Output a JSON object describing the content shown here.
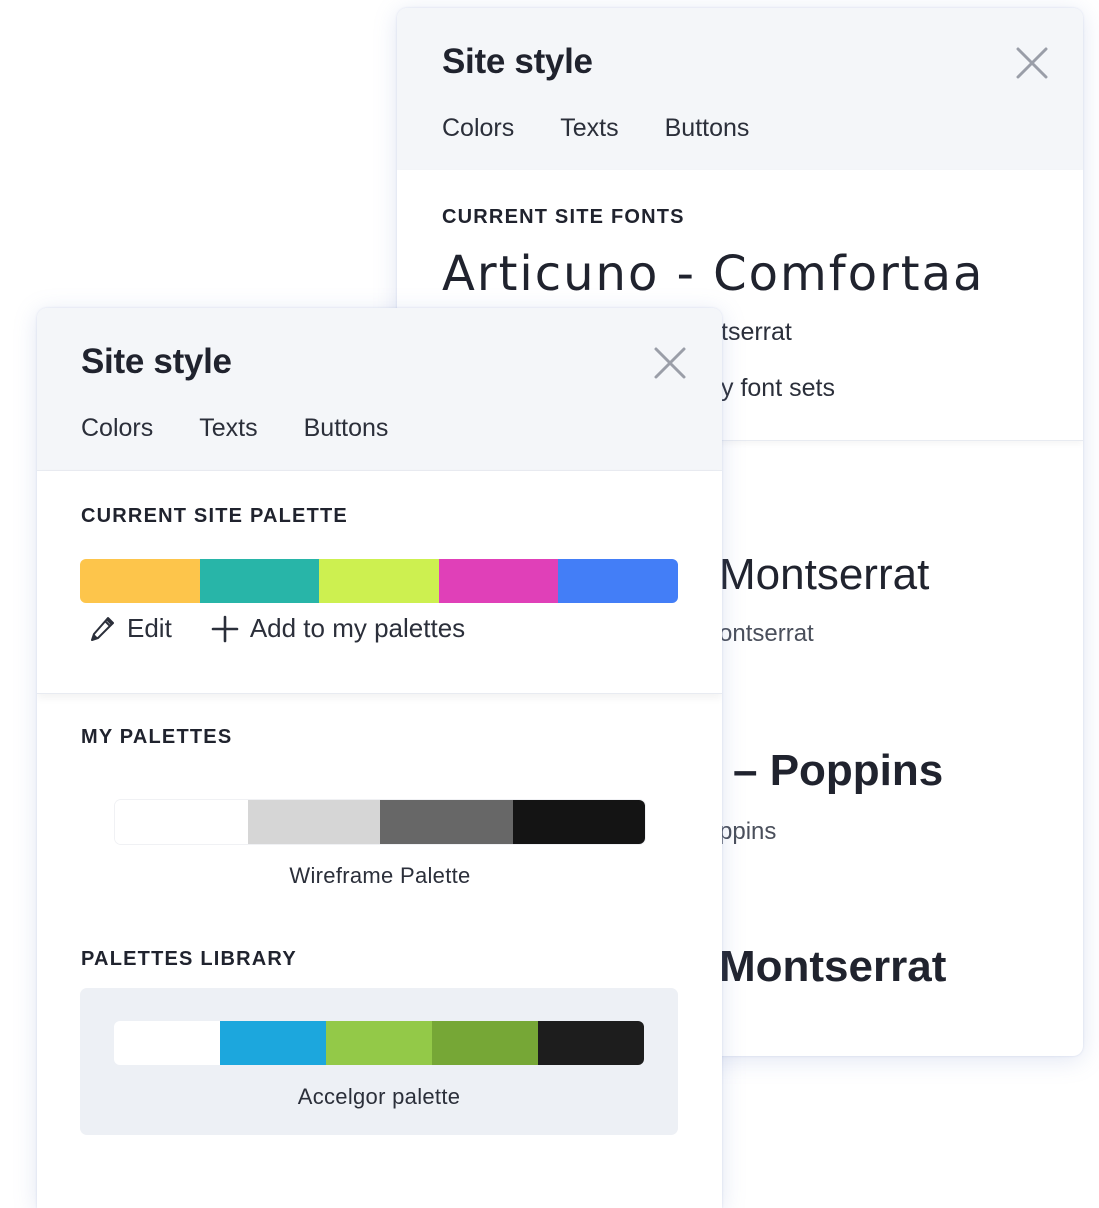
{
  "back_panel": {
    "title": "Site style",
    "tabs": [
      {
        "label": "Colors",
        "active": false
      },
      {
        "label": "Texts",
        "active": true
      },
      {
        "label": "Buttons",
        "active": false
      }
    ],
    "section_label": "CURRENT SITE FONTS",
    "current_font_title": "Articuno - Comfortaa",
    "current_font_subtitle_visible": "tserrat",
    "my_font_sets_link_visible": "y font sets",
    "font_sets": [
      {
        "title_visible": "Montserrat",
        "subtitle_visible": "ontserrat"
      },
      {
        "title_visible": "– Poppins",
        "subtitle_visible": "ppins"
      },
      {
        "title_visible": "Montserrat"
      }
    ]
  },
  "front_panel": {
    "title": "Site style",
    "tabs": [
      {
        "label": "Colors",
        "active": true
      },
      {
        "label": "Texts",
        "active": false
      },
      {
        "label": "Buttons",
        "active": false
      }
    ],
    "current_palette": {
      "label": "CURRENT SITE PALETTE",
      "colors": [
        "#fdc54b",
        "#28b5a8",
        "#cdf050",
        "#e040b8",
        "#437ef7"
      ],
      "edit_label": "Edit",
      "add_label": "Add to my palettes"
    },
    "my_palettes": {
      "label": "MY PALETTES",
      "palettes": [
        {
          "name": "Wireframe Palette",
          "colors": [
            "#ffffff",
            "#d6d6d6",
            "#676767",
            "#141414"
          ]
        }
      ]
    },
    "palettes_library": {
      "label": "PALETTES LIBRARY",
      "palettes": [
        {
          "name": "Accelgor palette",
          "colors": [
            "#ffffff",
            "#1ca7dd",
            "#93c948",
            "#76a736",
            "#1d1d1d"
          ]
        }
      ]
    }
  },
  "colors": {
    "accent": "#2f6fe0",
    "text": "#20232e",
    "header_bg": "#f4f6f9",
    "card_bg": "#edf0f5",
    "close_icon": "#9a9ea8"
  }
}
